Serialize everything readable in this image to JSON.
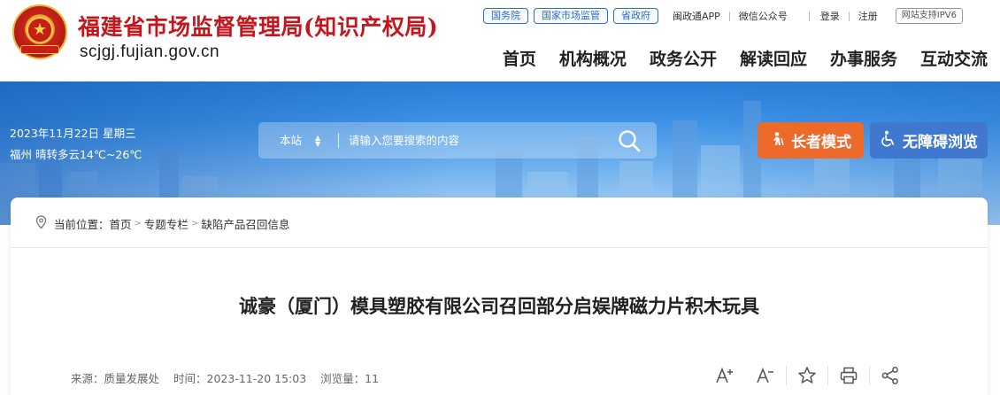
{
  "header": {
    "title": "福建省市场监督管理局(知识产权局)",
    "domain": "scjgj.fujian.gov.cn",
    "top_links": {
      "pills": [
        "国务院",
        "国家市场监管",
        "省政府"
      ],
      "app": "闽政通APP",
      "wechat": "微信公众号",
      "login": "登录",
      "register": "注册",
      "ipv6": "网站支持IPV6"
    },
    "nav": [
      "首页",
      "机构概况",
      "政务公开",
      "解读回应",
      "办事服务",
      "互动交流"
    ]
  },
  "banner": {
    "date": "2023年11月22日 星期三",
    "weather": "福州 晴转多云14℃~26℃",
    "search": {
      "scope": "本站",
      "placeholder": "请输入您要搜索的内容",
      "search_icon": "search-icon"
    },
    "elder_mode": "长者模式",
    "accessible_mode": "无障碍浏览"
  },
  "breadcrumb": {
    "label": "当前位置：",
    "items": [
      "首页",
      "专题专栏",
      "缺陷产品召回信息"
    ]
  },
  "article": {
    "title": "诚豪（厦门）模具塑胶有限公司召回部分启娱牌磁力片积木玩具",
    "source": "来源：质量发展处",
    "time": "时间：2023-11-20 15:03",
    "views": "浏览量：11"
  },
  "tools": [
    "font-increase-icon",
    "font-decrease-icon",
    "star-icon",
    "print-icon",
    "share-icon"
  ],
  "colors": {
    "title_red": "#c5161d",
    "link_blue": "#2a6fc9",
    "elder_orange": "#ec6a2a",
    "access_blue": "#3f78ce"
  }
}
